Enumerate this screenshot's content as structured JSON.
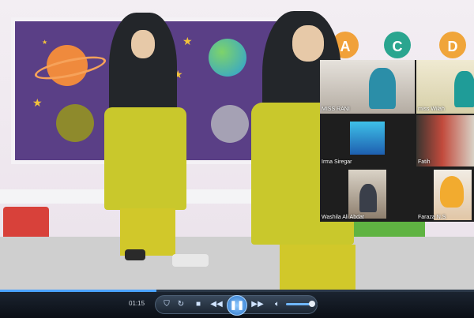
{
  "player": {
    "time": "01:15",
    "progress_fraction": 0.33,
    "volume_fraction": 0.82
  },
  "scene": {
    "letters": [
      "A",
      "C",
      "D"
    ],
    "letter_colors": [
      "#f1a13a",
      "#2aa58f",
      "#f0a53a"
    ]
  },
  "participants": [
    {
      "name": "MISS RANI",
      "active": true
    },
    {
      "name": "miss Wilah",
      "active": false
    },
    {
      "name": "Irma Siregar",
      "active": false
    },
    {
      "name": "Fatih",
      "active": false
    },
    {
      "name": "Washila Ali Abdat",
      "active": false
    },
    {
      "name": "Faraza N.S",
      "active": false
    }
  ],
  "colors": {
    "accent": "#4aa3ff",
    "active_speaker": "#f0d23a",
    "coat": "#c9c82c"
  },
  "icons": [
    "shield-icon",
    "repeat-icon",
    "stop-icon",
    "rewind-icon",
    "pause-icon",
    "fast-forward-icon",
    "volume-icon"
  ]
}
